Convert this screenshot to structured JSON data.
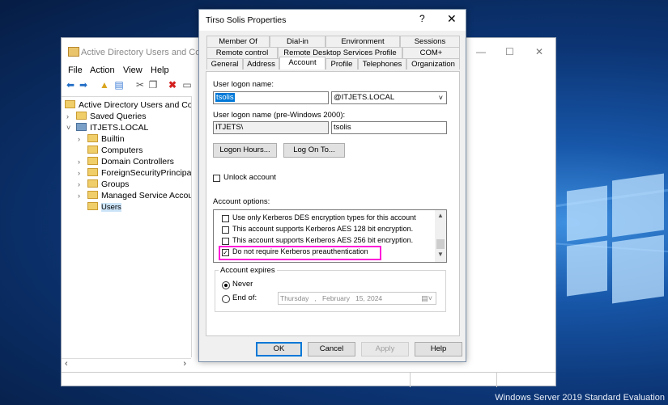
{
  "aduc": {
    "title": "Active Directory Users and Compu",
    "menu": [
      "File",
      "Action",
      "View",
      "Help"
    ],
    "tree": {
      "root": "Active Directory Users and Com",
      "saved_queries": "Saved Queries",
      "domain": "ITJETS.LOCAL",
      "children": [
        "Builtin",
        "Computers",
        "Domain Controllers",
        "ForeignSecurityPrincipals",
        "Groups",
        "Managed Service Accour",
        "Users"
      ],
      "selected": "Users"
    }
  },
  "dialog": {
    "title": "Tirso Solis Properties",
    "help_glyph": "?",
    "close_glyph": "✕",
    "tabs_row1": [
      "Member Of",
      "Dial-in",
      "Environment",
      "Sessions"
    ],
    "tabs_row2": [
      "Remote control",
      "Remote Desktop Services Profile",
      "COM+"
    ],
    "tabs_row3": [
      "General",
      "Address",
      "Account",
      "Profile",
      "Telephones",
      "Organization"
    ],
    "active_tab": "Account",
    "logon_name_label": "User logon name:",
    "logon_name_value": "tsolis",
    "upn_suffix": "@ITJETS.LOCAL",
    "pre2000_label": "User logon name (pre-Windows 2000):",
    "pre2000_domain": "ITJETS\\",
    "pre2000_user": "tsolis",
    "logon_hours_button": "Logon Hours...",
    "logon_to_button": "Log On To...",
    "unlock_label": "Unlock account",
    "account_options_label": "Account options:",
    "account_options": [
      {
        "label": "Use only Kerberos DES encryption types for this account",
        "checked": false
      },
      {
        "label": "This account supports Kerberos AES 128 bit encryption.",
        "checked": false
      },
      {
        "label": "This account supports Kerberos AES 256 bit encryption.",
        "checked": false
      },
      {
        "label": "Do not require Kerberos preauthentication",
        "checked": true
      }
    ],
    "account_expires_label": "Account expires",
    "never_label": "Never",
    "end_of_label": "End of:",
    "end_of_date": "Thursday   ,   February   15, 2024",
    "expires_selected": "never",
    "ok_button": "OK",
    "cancel_button": "Cancel",
    "apply_button": "Apply",
    "help_button": "Help"
  },
  "watermark": "Windows Server 2019 Standard Evaluation",
  "colors": {
    "highlight": "#ff19d9",
    "selection": "#0078d7"
  }
}
